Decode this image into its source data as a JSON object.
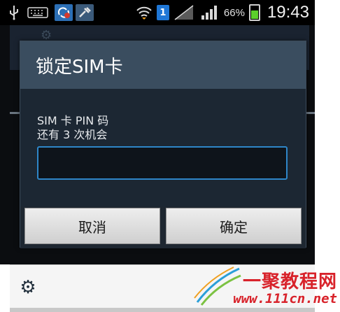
{
  "status_bar": {
    "icons": [
      "usb-icon",
      "keyboard-icon",
      "sync-alert-icon",
      "tool-icon",
      "wifi-icon",
      "sim-1-icon",
      "no-signal-icon",
      "signal-icon",
      "battery-charging-icon"
    ],
    "sim_slot": "1",
    "battery_pct": "66%",
    "time": "19:43"
  },
  "dialog": {
    "title": "锁定SIM卡",
    "prompt_line1": "SIM 卡 PIN 码",
    "prompt_line2": "还有 3 次机会",
    "pin_value": "",
    "cancel_label": "取消",
    "ok_label": "确定"
  },
  "bottom_bar": {
    "icons": [
      "settings-gear-icon"
    ]
  },
  "watermark": {
    "brand": "一聚教程网",
    "url": "www.111cn.net"
  },
  "colors": {
    "dialog_header": "#3a4d5f",
    "dialog_body": "#1c2733",
    "input_border": "#2e86c8",
    "watermark_red": "#d8222a"
  }
}
